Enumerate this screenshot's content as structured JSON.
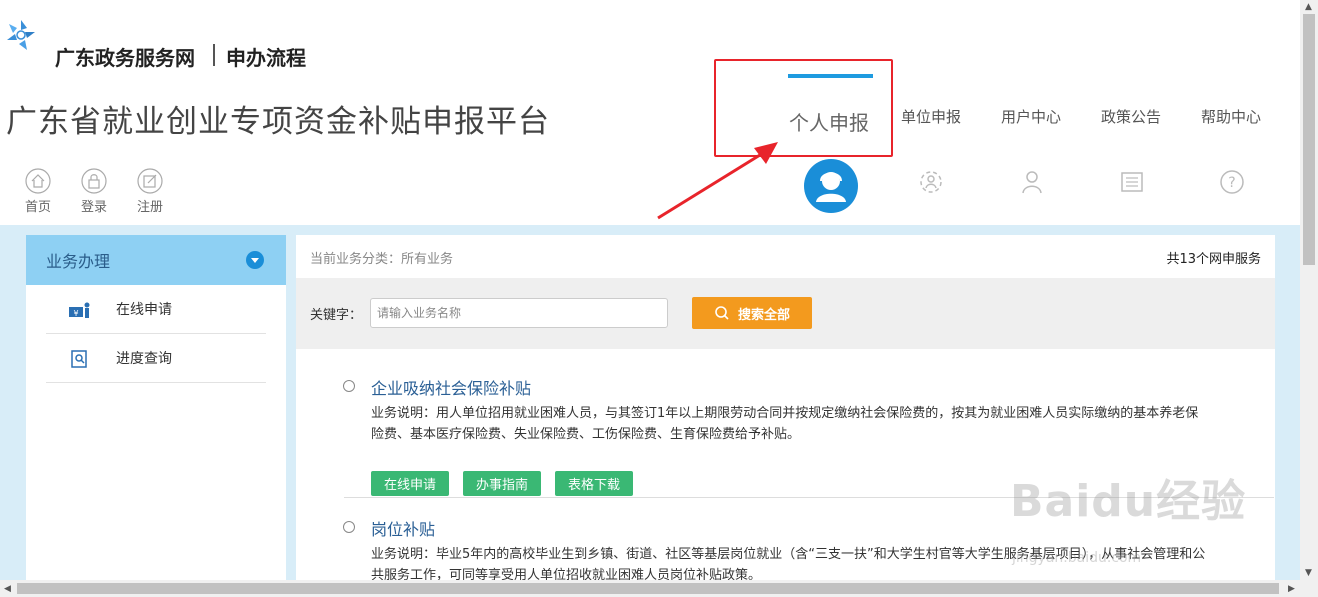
{
  "header": {
    "portal_name": "广东政务服务网",
    "section_name": "申办流程",
    "platform_title": "广东省就业创业专项资金补贴申报平台"
  },
  "nav": {
    "items": [
      {
        "label": "个人申报",
        "active": true,
        "icon": "person-icon"
      },
      {
        "label": "单位申报",
        "active": false,
        "icon": "organization-icon"
      },
      {
        "label": "用户中心",
        "active": false,
        "icon": "user-icon"
      },
      {
        "label": "政策公告",
        "active": false,
        "icon": "document-icon"
      },
      {
        "label": "帮助中心",
        "active": false,
        "icon": "help-icon"
      }
    ],
    "accent_color": "#1e9be0"
  },
  "quick_links": [
    {
      "label": "首页",
      "icon": "home-icon"
    },
    {
      "label": "登录",
      "icon": "lock-icon"
    },
    {
      "label": "注册",
      "icon": "edit-icon"
    }
  ],
  "sidebar": {
    "title": "业务办理",
    "items": [
      {
        "label": "在线申请",
        "icon": "apply-icon"
      },
      {
        "label": "进度查询",
        "icon": "search-doc-icon"
      }
    ]
  },
  "panel": {
    "category": "当前业务分类：所有业务",
    "total": "共13个网申服务",
    "keyword_label": "关键字：",
    "search_placeholder": "请输入业务名称",
    "search_button": "搜索全部"
  },
  "services": [
    {
      "title": "企业吸纳社会保险补贴",
      "desc": "业务说明：用人单位招用就业困难人员，与其签订1年以上期限劳动合同并按规定缴纳社会保险费的，按其为就业困难人员实际缴纳的基本养老保险费、基本医疗保险费、失业保险费、工伤保险费、生育保险费给予补贴。",
      "buttons": [
        "在线申请",
        "办事指南",
        "表格下载"
      ]
    },
    {
      "title": "岗位补贴",
      "desc": "业务说明：毕业5年内的高校毕业生到乡镇、街道、社区等基层岗位就业（含“三支一扶”和大学生村官等大学生服务基层项目），从事社会管理和公共服务工作，可同等享受用人单位招收就业困难人员岗位补贴政策。"
    }
  ],
  "watermark": {
    "text": "Baidu经验",
    "url": "jingyan.baidu.com"
  },
  "colors": {
    "highlight": "#e8242b",
    "search_button": "#f39a1e",
    "service_button": "#3ab874",
    "band": "#d8edf8"
  }
}
